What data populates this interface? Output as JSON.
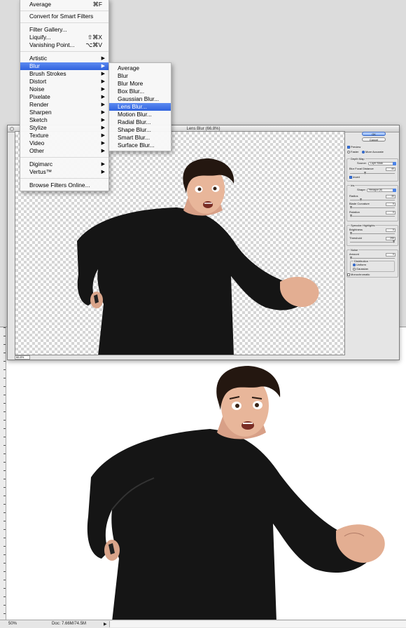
{
  "filter_menu": {
    "items": [
      {
        "label": "Average",
        "shortcut": "⌘F"
      },
      {
        "label": "Convert for Smart Filters"
      },
      {
        "label": "Filter Gallery..."
      },
      {
        "label": "Liquify...",
        "shortcut": "⇧⌘X"
      },
      {
        "label": "Vanishing Point...",
        "shortcut": "⌥⌘V"
      },
      {
        "label": "Artistic"
      },
      {
        "label": "Blur"
      },
      {
        "label": "Brush Strokes"
      },
      {
        "label": "Distort"
      },
      {
        "label": "Noise"
      },
      {
        "label": "Pixelate"
      },
      {
        "label": "Render"
      },
      {
        "label": "Sharpen"
      },
      {
        "label": "Sketch"
      },
      {
        "label": "Stylize"
      },
      {
        "label": "Texture"
      },
      {
        "label": "Video"
      },
      {
        "label": "Other"
      },
      {
        "label": "Digimarc"
      },
      {
        "label": "Vertus™"
      },
      {
        "label": "Browse Filters Online..."
      }
    ],
    "arrow": "▶"
  },
  "blur_submenu": {
    "items": [
      "Average",
      "Blur",
      "Blur More",
      "Box Blur...",
      "Gaussian Blur...",
      "Lens Blur...",
      "Motion Blur...",
      "Radial Blur...",
      "Shape Blur...",
      "Smart Blur...",
      "Surface Blur..."
    ],
    "highlighted": "Lens Blur..."
  },
  "dialog": {
    "title": "Lens Blur (66.8%)",
    "zoom": "66.8%",
    "ok": "OK",
    "cancel": "Cancel",
    "preview": "Preview",
    "faster": "Faster",
    "more_accurate": "More Accurate",
    "depth_map": "Depth Map",
    "source_label": "Source:",
    "source_value": "Layer Mask",
    "blur_focal_distance": "Blur Focal Distance",
    "blur_focal_value": "40",
    "invert": "Invert",
    "iris": "Iris",
    "shape_label": "Shape:",
    "shape_value": "Hexagon (6)",
    "radius": "Radius",
    "radius_value": "30",
    "blade_curvature": "Blade Curvature",
    "blade_value": "0",
    "rotation": "Rotation",
    "rotation_value": "0",
    "specular": "Specular Highlights",
    "brightness": "Brightness",
    "brightness_value": "0",
    "threshold": "Threshold",
    "threshold_value": "255",
    "noise": "Noise",
    "amount": "Amount",
    "amount_value": "0",
    "distribution": "Distribution",
    "uniform": "Uniform",
    "gaussian": "Gaussian",
    "monochromatic": "Monochromatic"
  },
  "document": {
    "zoom": "50%",
    "doc_size": "Doc: 7.66M/74.5M"
  },
  "colors": {
    "highlight": "#2f62de",
    "sweater": "#151515",
    "hair": "#241710",
    "skin": "#e8b69a"
  }
}
